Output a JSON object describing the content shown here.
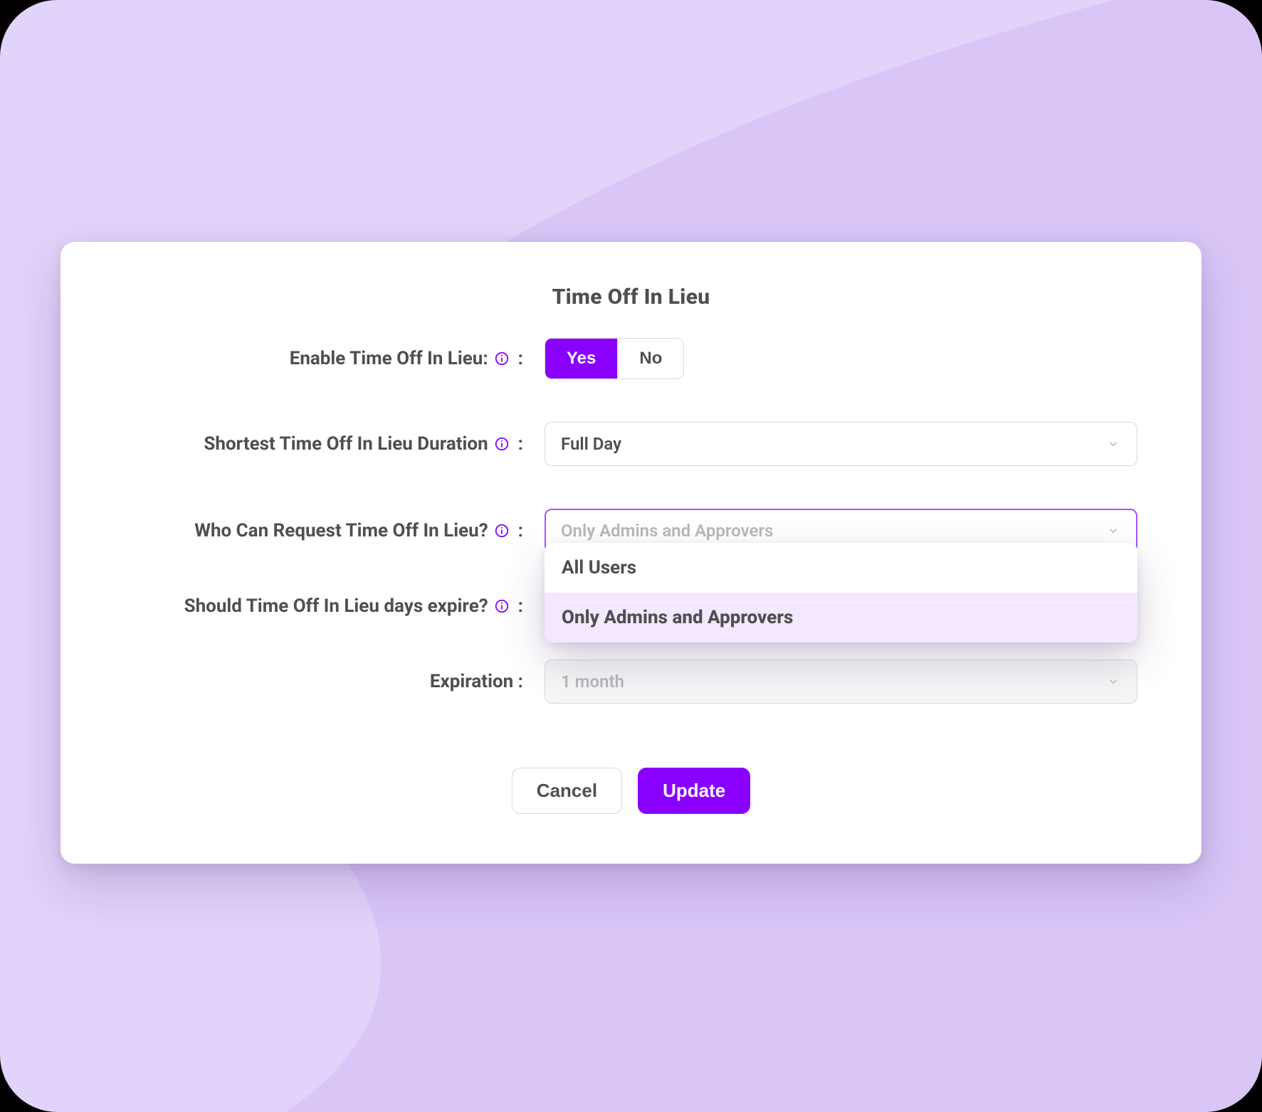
{
  "colors": {
    "background": "#E2D3FA",
    "accent": "#8A00FF",
    "focusRing": "#A259FF",
    "textMuted": "#4F4F4F",
    "optionSelectedBg": "#F3E8FF"
  },
  "panel": {
    "title": "Time Off In Lieu"
  },
  "enable": {
    "label": "Enable Time Off In Lieu:",
    "options": {
      "yes": "Yes",
      "no": "No"
    },
    "selected": "yes"
  },
  "duration": {
    "label": "Shortest Time Off In Lieu Duration",
    "value": "Full Day"
  },
  "whoCanRequest": {
    "label": "Who Can Request Time Off In Lieu?",
    "placeholder": "Only Admins and Approvers",
    "options": [
      "All Users",
      "Only Admins and Approvers"
    ],
    "selectedIndex": 1,
    "dropdownOpen": true
  },
  "expire": {
    "label": "Should Time Off In Lieu days expire?"
  },
  "expiration": {
    "label": "Expiration :",
    "value": "1 month"
  },
  "footer": {
    "cancel": "Cancel",
    "update": "Update"
  }
}
